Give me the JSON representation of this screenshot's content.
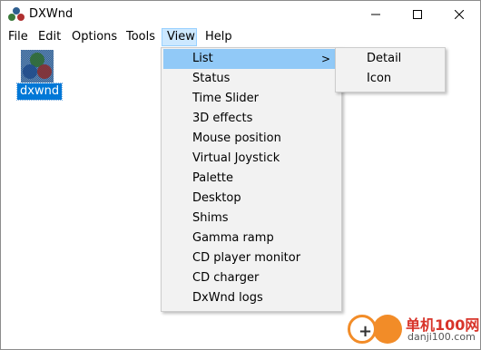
{
  "window": {
    "title": "DXWnd",
    "controls": [
      "minimize",
      "maximize",
      "close"
    ]
  },
  "menubar": {
    "items": [
      "File",
      "Edit",
      "Options",
      "Tools",
      "View",
      "Help"
    ],
    "active": "View"
  },
  "list": {
    "items": [
      {
        "label": "dxwnd",
        "icon": "dxwnd-app-icon",
        "selected": true
      }
    ]
  },
  "view_menu": {
    "items": [
      {
        "label": "List",
        "has_submenu": true,
        "highlighted": true
      },
      {
        "label": "Status"
      },
      {
        "label": "Time Slider"
      },
      {
        "label": "3D effects"
      },
      {
        "label": "Mouse position"
      },
      {
        "label": "Virtual Joystick"
      },
      {
        "label": "Palette"
      },
      {
        "label": "Desktop"
      },
      {
        "label": "Shims"
      },
      {
        "label": "Gamma ramp"
      },
      {
        "label": "CD player monitor"
      },
      {
        "label": "CD charger"
      },
      {
        "label": "DxWnd logs"
      }
    ],
    "submenu_arrow": ">"
  },
  "list_submenu": {
    "items": [
      "Detail",
      "Icon"
    ]
  },
  "watermark": {
    "plus_glyph": "+",
    "text_main": "单机100网",
    "text_url": "danji100.com",
    "accent_color": "#f28c28",
    "text_color": "#d8342a"
  },
  "colors": {
    "menu_highlight": "#91c9f7",
    "selection": "#0078d7",
    "menu_bg": "#f2f2f2"
  }
}
